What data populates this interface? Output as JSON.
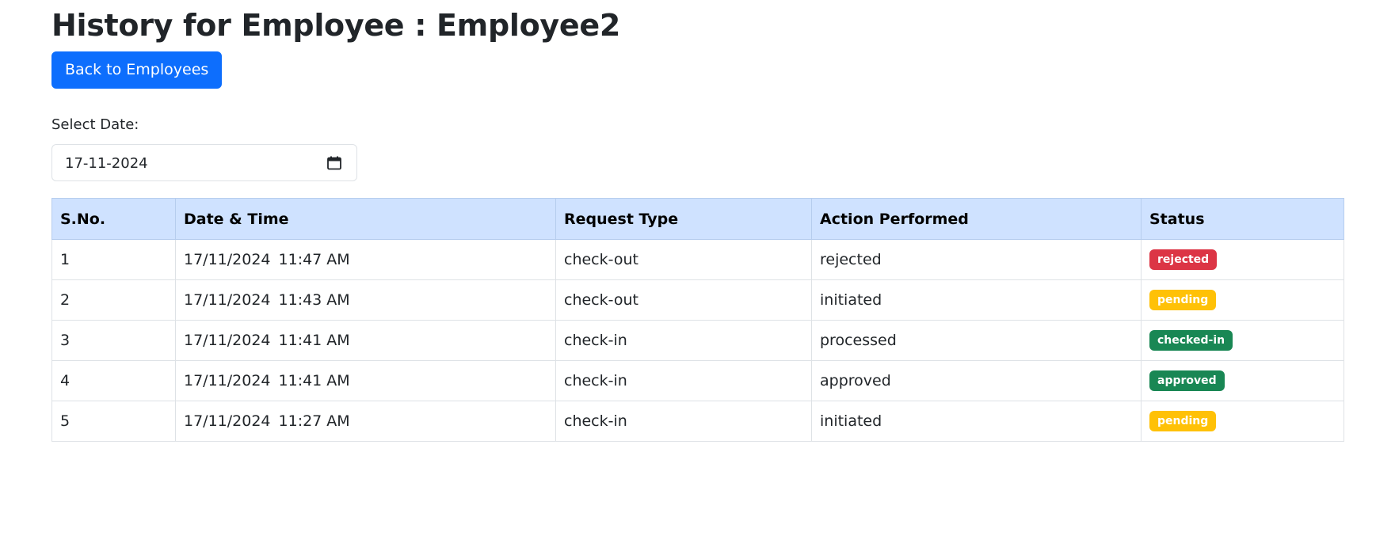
{
  "page": {
    "title": "History for Employee : Employee2",
    "back_button_label": "Back to Employees"
  },
  "filter": {
    "label": "Select Date:",
    "date_value": "17-11-2024",
    "calendar_icon": "calendar-icon"
  },
  "table": {
    "headers": {
      "sno": "S.No.",
      "datetime": "Date & Time",
      "request_type": "Request Type",
      "action": "Action Performed",
      "status": "Status"
    },
    "rows": [
      {
        "sno": "1",
        "date": "17/11/2024",
        "time": "11:47 AM",
        "request_type": "check-out",
        "action": "rejected",
        "status": "rejected"
      },
      {
        "sno": "2",
        "date": "17/11/2024",
        "time": "11:43 AM",
        "request_type": "check-out",
        "action": "initiated",
        "status": "pending"
      },
      {
        "sno": "3",
        "date": "17/11/2024",
        "time": "11:41 AM",
        "request_type": "check-in",
        "action": "processed",
        "status": "checked-in"
      },
      {
        "sno": "4",
        "date": "17/11/2024",
        "time": "11:41 AM",
        "request_type": "check-in",
        "action": "approved",
        "status": "approved"
      },
      {
        "sno": "5",
        "date": "17/11/2024",
        "time": "11:27 AM",
        "request_type": "check-in",
        "action": "initiated",
        "status": "pending"
      }
    ]
  },
  "colors": {
    "primary": "#0d6efd",
    "header_bg": "#cfe2ff",
    "rejected": "#dc3545",
    "pending": "#ffc107",
    "success": "#198754"
  }
}
